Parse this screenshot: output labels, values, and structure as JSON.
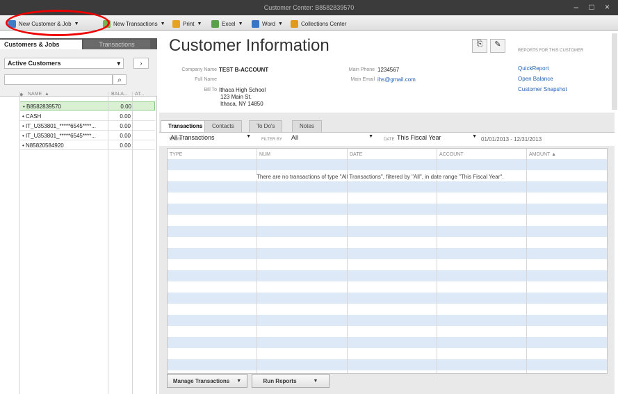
{
  "window": {
    "title": "Customer Center: B8582839570",
    "controls": "– □ ×"
  },
  "toolbar": {
    "new_customer_job": "New Customer & Job",
    "new_transactions": "New Transactions",
    "print": "Print",
    "excel": "Excel",
    "word": "Word",
    "collections_center": "Collections Center"
  },
  "sidebar": {
    "tabs": [
      "Customers & Jobs",
      "Transactions"
    ],
    "filter": {
      "selected": "Active Customers",
      "arrow": "›",
      "search_placeholder": ""
    },
    "columns": {
      "name": "NAME",
      "balance": "BALA...",
      "attach": "AT..."
    },
    "rows": [
      {
        "name": "• B8582839570",
        "balance": "0.00"
      },
      {
        "name": "• CASH",
        "balance": "0.00"
      },
      {
        "name": "• IT_U353801_*****6545****...",
        "balance": "0.00"
      },
      {
        "name": "• IT_U353801_*****6545****...",
        "balance": "0.00"
      },
      {
        "name": "• N85820584920",
        "balance": "0.00"
      }
    ]
  },
  "info": {
    "title": "Customer Information",
    "company_label": "Company Name",
    "company_value": "TEST B-ACCOUNT",
    "fullname_label": "Full Name",
    "billto_label": "Bill To",
    "billto_lines": [
      "Ithaca High School",
      "123 Main St.",
      "Ithaca, NY 14850"
    ],
    "phone_label": "Main Phone",
    "phone_value": "1234567",
    "email_label": "Main Email",
    "email_value": "ihs@gmail.com",
    "reports_header": "REPORTS FOR THIS CUSTOMER",
    "reports": [
      "QuickReport",
      "Open Balance",
      "Customer Snapshot"
    ]
  },
  "tabs": [
    "Transactions",
    "Contacts",
    "To Do's",
    "Notes"
  ],
  "filters": {
    "show_label": "SHOW",
    "show_value": "All Transactions",
    "filter_label": "FILTER BY",
    "filter_value": "All",
    "date_label": "DATE",
    "date_value": "This Fiscal Year",
    "date_range": "01/01/2013 - 12/31/2013"
  },
  "table": {
    "columns": [
      "TYPE",
      "NUM",
      "DATE",
      "ACCOUNT",
      "AMOUNT ▲"
    ],
    "empty_message": "There are no transactions of type \"All Transactions\", filtered by \"All\", in date range \"This Fiscal Year\"."
  },
  "buttons": {
    "manage_transactions": "Manage Transactions",
    "run_reports": "Run Reports"
  },
  "colors": {
    "accent": "#2563b6",
    "row_alt": "#dde9f7",
    "selected_row": "#d9f0d3",
    "annotation": "#ee0000"
  }
}
